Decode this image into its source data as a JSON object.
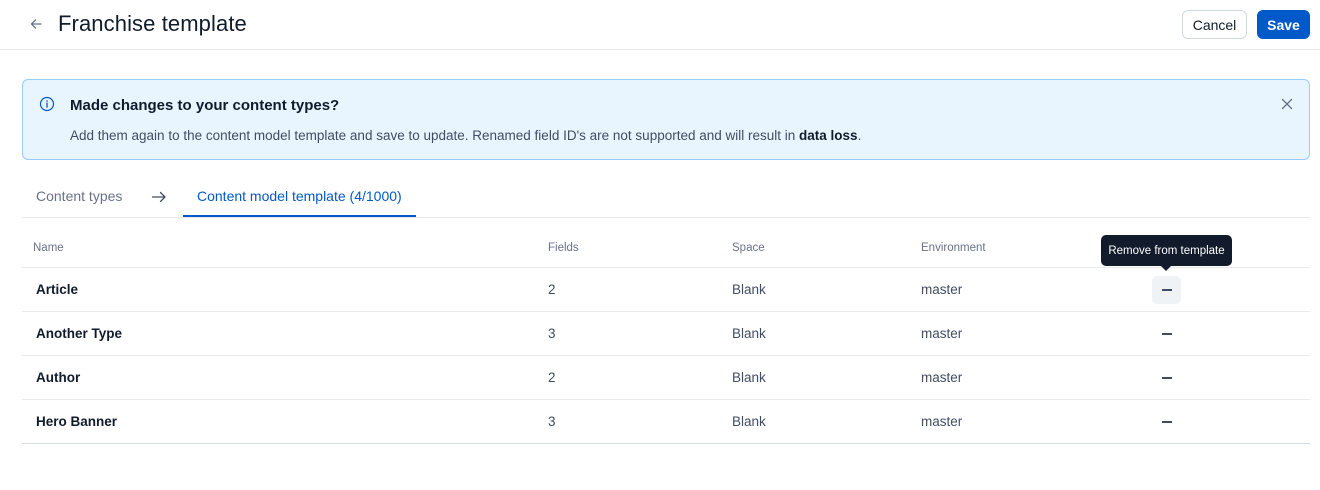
{
  "header": {
    "back_icon": "arrow-left-icon",
    "title": "Franchise template",
    "cancel_label": "Cancel",
    "save_label": "Save"
  },
  "notice": {
    "icon": "info-icon",
    "title": "Made changes to your content types?",
    "body_prefix": "Add them again to the content model template and save to update. Renamed field ID's are not supported and will result in ",
    "body_emphasis": "data loss",
    "body_suffix": ".",
    "close_icon": "close-icon"
  },
  "tabs": {
    "first": "Content types",
    "arrow_icon": "arrow-right-icon",
    "second": "Content model template (4/1000)"
  },
  "table": {
    "columns": [
      "Name",
      "Fields",
      "Space",
      "Environment"
    ],
    "rows": [
      {
        "name": "Article",
        "fields": "2",
        "space": "Blank",
        "environment": "master"
      },
      {
        "name": "Another Type",
        "fields": "3",
        "space": "Blank",
        "environment": "master"
      },
      {
        "name": "Author",
        "fields": "2",
        "space": "Blank",
        "environment": "master"
      },
      {
        "name": "Hero Banner",
        "fields": "3",
        "space": "Blank",
        "environment": "master"
      }
    ],
    "remove_icon": "minus-icon"
  },
  "tooltip": {
    "text": "Remove from template"
  },
  "colors": {
    "primary": "#0059c8",
    "notice_bg": "#e8f5ff",
    "notice_border": "#98cbff",
    "tooltip_bg": "#111b2b"
  }
}
